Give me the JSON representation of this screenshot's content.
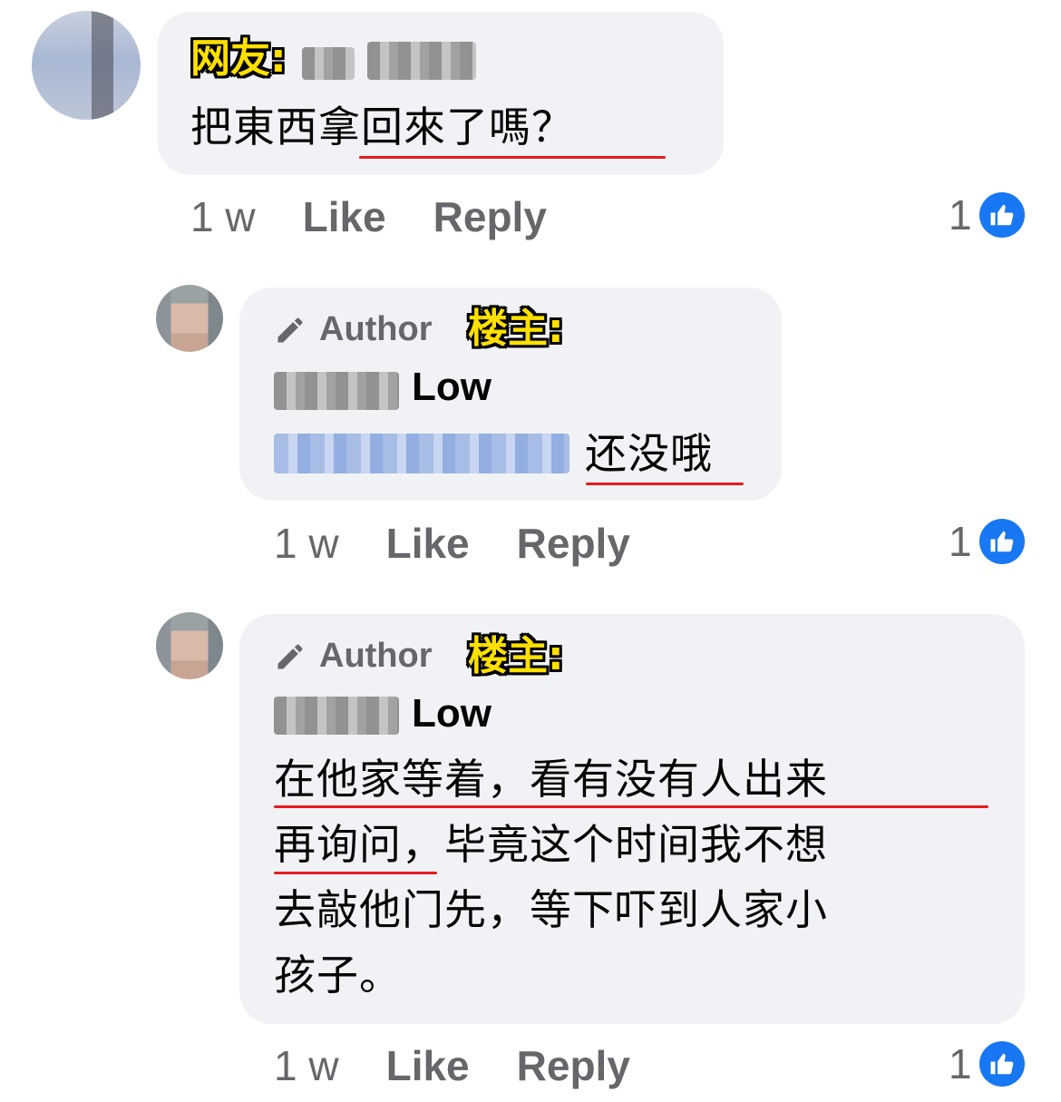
{
  "comments": [
    {
      "tag": "网友:",
      "text": "把東西拿回來了嗎？",
      "meta": {
        "time": "1 w",
        "like": "Like",
        "reply": "Reply"
      },
      "reactions": "1"
    },
    {
      "author_badge": "Author",
      "tag": "楼主:",
      "name_visible": "Low",
      "text": "还没哦",
      "meta": {
        "time": "1 w",
        "like": "Like",
        "reply": "Reply"
      },
      "reactions": "1"
    },
    {
      "author_badge": "Author",
      "tag": "楼主:",
      "name_visible": "Low",
      "text_lines": [
        "在他家等着，看有没有人出来",
        "再询问，毕竟这个时间我不想",
        "去敲他门先，等下吓到人家小",
        "孩子。"
      ],
      "meta": {
        "time": "1 w",
        "like": "Like",
        "reply": "Reply"
      },
      "reactions": "1"
    }
  ],
  "colors": {
    "bubble": "#f0f2f5",
    "meta": "#65676b",
    "like_blue": "#1877f2",
    "tag_yellow": "#ffe000",
    "underline": "#e8191f"
  },
  "icons": {
    "author": "pencil-icon",
    "reaction": "thumbs-up-icon"
  }
}
